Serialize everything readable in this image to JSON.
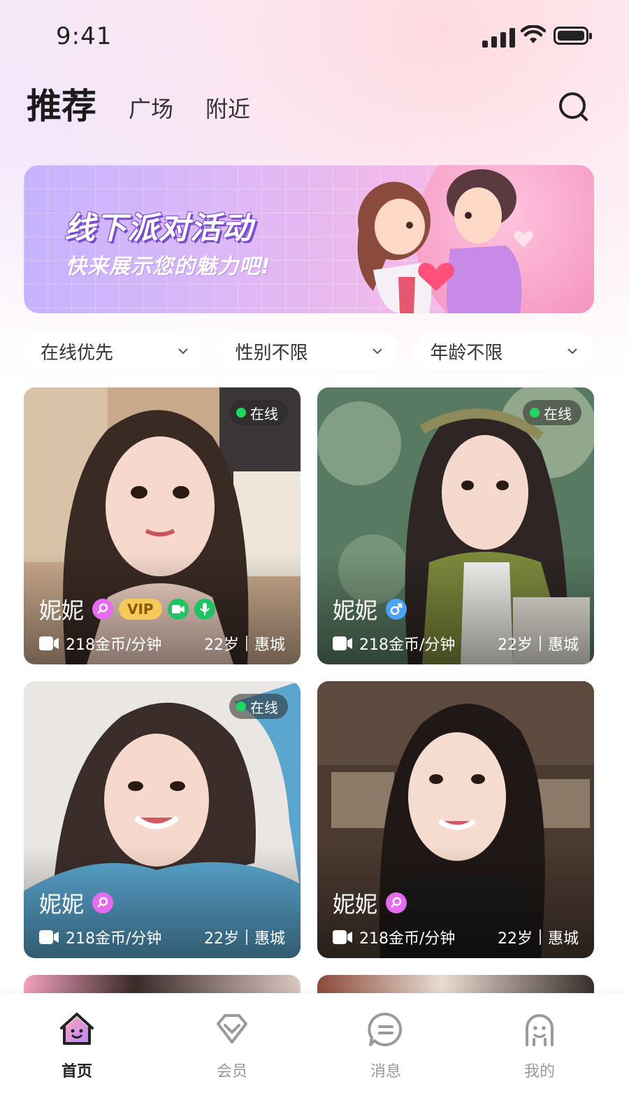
{
  "status_bar": {
    "time": "9:41"
  },
  "header": {
    "tabs": [
      {
        "label": "推荐",
        "active": true
      },
      {
        "label": "广场",
        "active": false
      },
      {
        "label": "附近",
        "active": false
      }
    ],
    "search_icon": "search-icon"
  },
  "banner": {
    "title": "线下派对活动",
    "subtitle": "快来展示您的魅力吧!"
  },
  "filters": [
    {
      "label": "在线优先"
    },
    {
      "label": "性别不限"
    },
    {
      "label": "年龄不限"
    }
  ],
  "cards": [
    {
      "name": "妮妮",
      "gender": "female",
      "online": "在线",
      "vip": "VIP",
      "video": true,
      "voice": true,
      "price": "218金币/分钟",
      "age": "22岁",
      "city": "惠城"
    },
    {
      "name": "妮妮",
      "gender": "male",
      "online": "在线",
      "price": "218金币/分钟",
      "age": "22岁",
      "city": "惠城"
    },
    {
      "name": "妮妮",
      "gender": "female",
      "online": "在线",
      "price": "218金币/分钟",
      "age": "22岁",
      "city": "惠城"
    },
    {
      "name": "妮妮",
      "gender": "female",
      "price": "218金币/分钟",
      "age": "22岁",
      "city": "惠城"
    }
  ],
  "tabbar": [
    {
      "label": "首页",
      "icon": "home-icon",
      "active": true
    },
    {
      "label": "会员",
      "icon": "diamond-icon",
      "active": false
    },
    {
      "label": "消息",
      "icon": "message-icon",
      "active": false
    },
    {
      "label": "我的",
      "icon": "profile-icon",
      "active": false
    }
  ],
  "colors": {
    "accent": "#e76bf0",
    "online": "#1ed760",
    "vip": "#f5c95a",
    "male": "#4aa3f5"
  }
}
